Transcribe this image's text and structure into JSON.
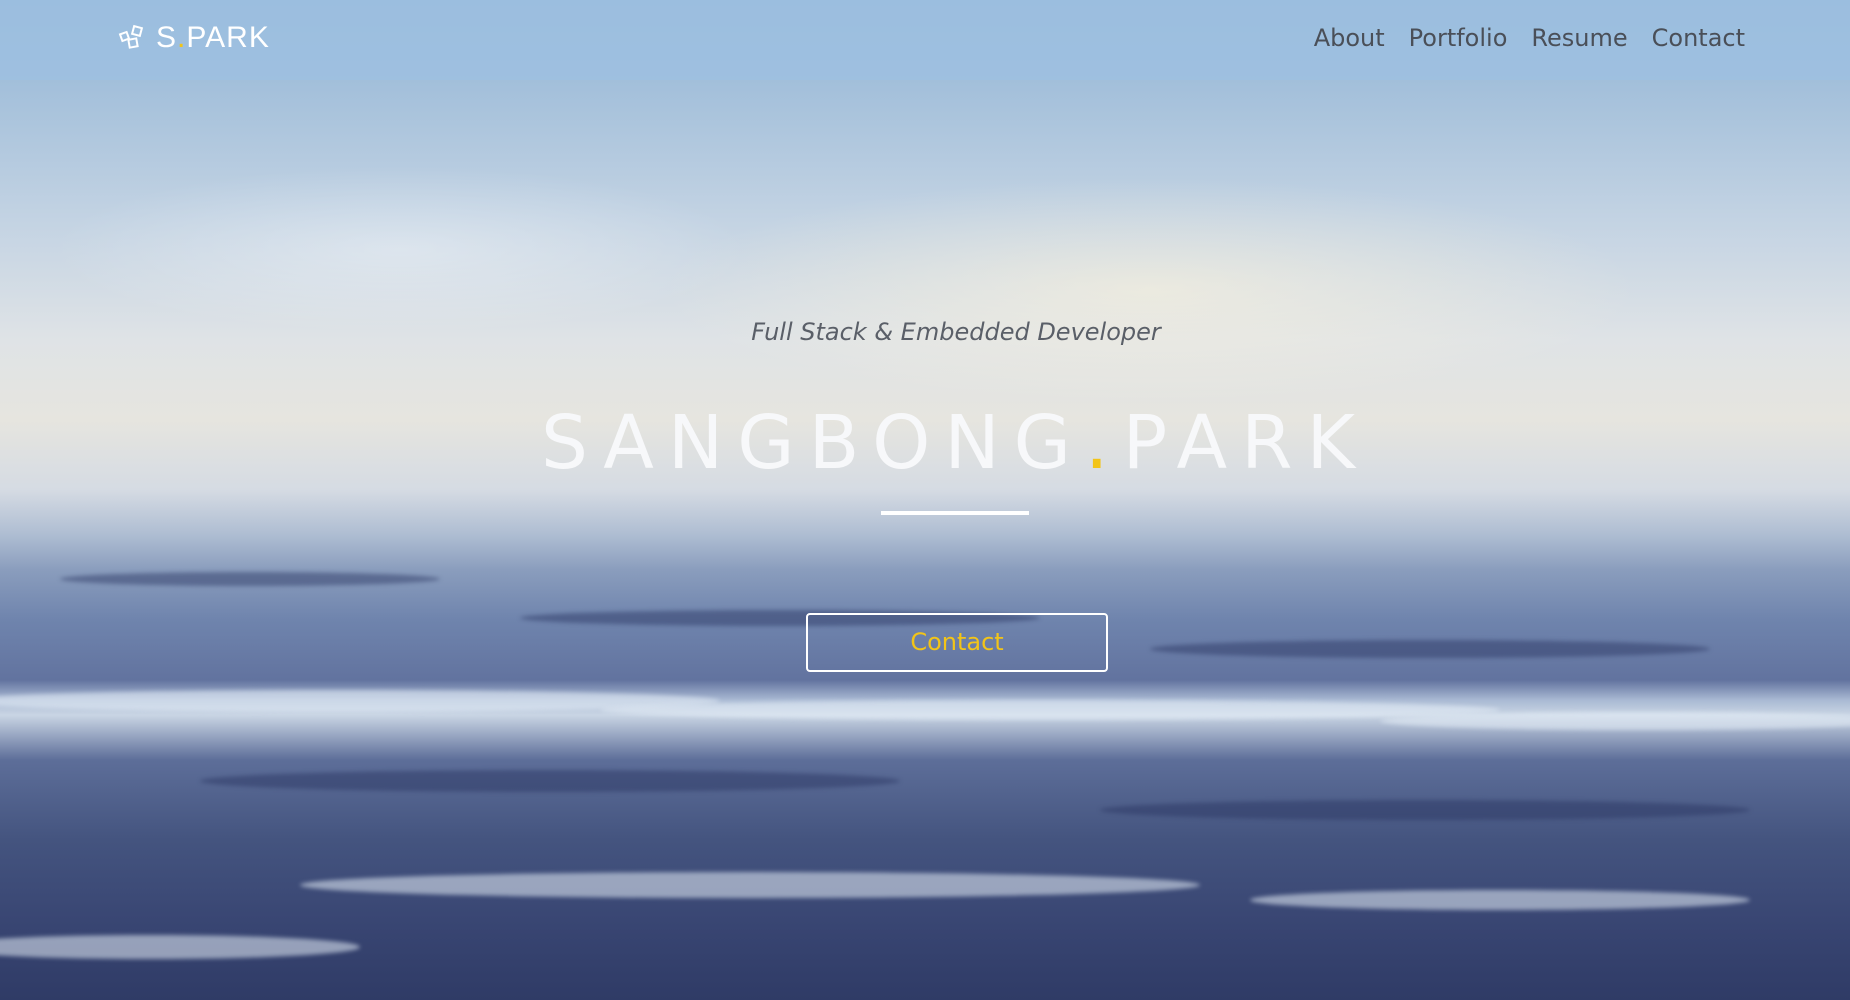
{
  "navbar": {
    "brand": {
      "logo_icon": "boxes-icon",
      "text_prefix": "S",
      "text_dot": ".",
      "text_suffix": "PARK"
    },
    "links": [
      {
        "label": "About"
      },
      {
        "label": "Portfolio"
      },
      {
        "label": "Resume"
      },
      {
        "label": "Contact"
      }
    ]
  },
  "hero": {
    "subtitle": "Full Stack & Embedded Developer",
    "title_first": "SANGBONG",
    "title_dot": ".",
    "title_last": "PARK",
    "cta_label": "Contact"
  },
  "colors": {
    "accent": "#f2c418",
    "nav_bg": "#9ec0e0",
    "nav_text": "#4a4f58",
    "hero_text": "#f7f8fa"
  }
}
